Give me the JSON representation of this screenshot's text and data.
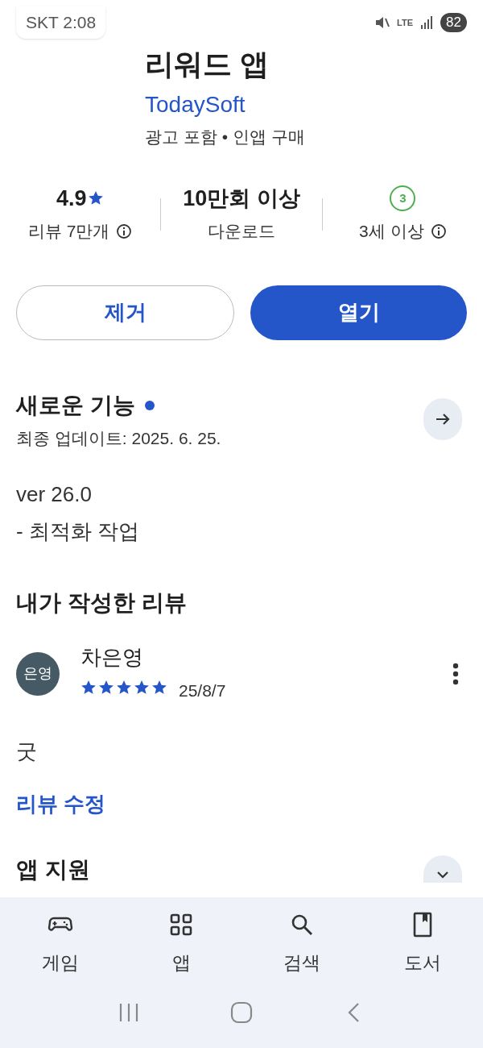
{
  "status_bar": {
    "carrier_time": "SKT 2:08",
    "network": "LTE",
    "battery": "82"
  },
  "app": {
    "title": "리워드 앱",
    "developer": "TodaySoft",
    "tags": "광고 포함 • 인앱 구매"
  },
  "stats": [
    {
      "kind": "rating",
      "value": "4.9",
      "label": "리뷰 7만개",
      "info": true
    },
    {
      "kind": "text",
      "value": "10만회 이상",
      "label": "다운로드",
      "info": false
    },
    {
      "kind": "age",
      "value": "3",
      "label": "3세 이상",
      "info": true
    }
  ],
  "buttons": [
    {
      "label": "제거",
      "kind": "outline"
    },
    {
      "label": "열기",
      "kind": "filled"
    }
  ],
  "whats_new": {
    "title": "새로운 기능",
    "has_new": true,
    "updated": "최종 업데이트: 2025. 6. 25.",
    "lines": [
      "ver 26.0",
      "- 최적화 작업"
    ]
  },
  "my_review": {
    "heading": "내가 작성한 리뷰",
    "avatar": "은영",
    "author": "차은영",
    "stars": 5,
    "date": "25/8/7",
    "text": "굿",
    "edit_link": "리뷰 수정"
  },
  "next_section": {
    "title": "앱 지원"
  },
  "bottom_nav": [
    {
      "label": "게임",
      "kind": "game"
    },
    {
      "label": "앱",
      "kind": "apps"
    },
    {
      "label": "검색",
      "kind": "search"
    },
    {
      "label": "도서",
      "kind": "book"
    }
  ]
}
